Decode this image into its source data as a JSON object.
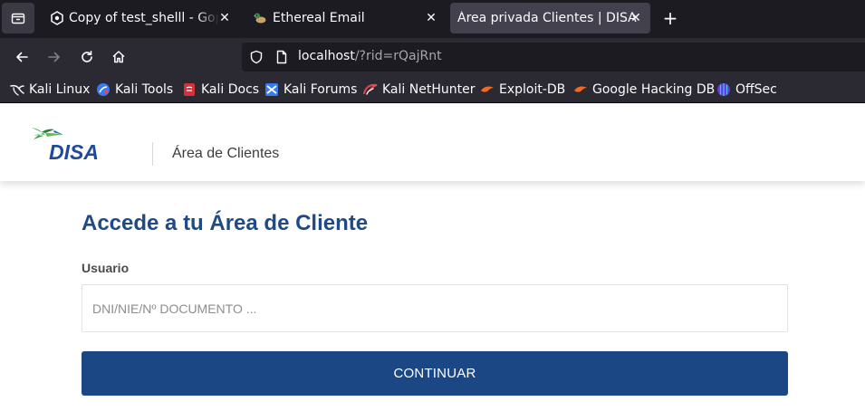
{
  "browser": {
    "tabs": [
      {
        "title": "Copy of test_shelll - Gophish",
        "favicon": "gophish-hex-icon",
        "active": false
      },
      {
        "title": "Ethereal Email",
        "favicon": "duck-icon",
        "active": false
      },
      {
        "title": "Área privada Clientes | DISA",
        "favicon": "none",
        "active": true
      }
    ],
    "close_glyph": "✕",
    "newtab_glyph": "+",
    "url_host": "localhost",
    "url_path": "/?rid=rQajRnt",
    "bookmarks": [
      {
        "label": "Kali Linux",
        "icon": "kali-dragon-icon"
      },
      {
        "label": "Kali Tools",
        "icon": "kali-tools-icon"
      },
      {
        "label": "Kali Docs",
        "icon": "kali-docs-icon"
      },
      {
        "label": "Kali Forums",
        "icon": "kali-forums-icon"
      },
      {
        "label": "Kali NetHunter",
        "icon": "nethunter-icon"
      },
      {
        "label": "Exploit-DB",
        "icon": "exploit-db-icon"
      },
      {
        "label": "Google Hacking DB",
        "icon": "ghdb-icon"
      },
      {
        "label": "OffSec",
        "icon": "offsec-icon"
      }
    ]
  },
  "header": {
    "logo_text": "DISA",
    "section_title": "Área de Clientes"
  },
  "login": {
    "title": "Accede a tu Área de Cliente",
    "user_label": "Usuario",
    "user_value": "",
    "user_placeholder": "DNI/NIE/Nº DOCUMENTO ...",
    "submit_label": "CONTINUAR"
  },
  "colors": {
    "brand_blue": "#1c4785",
    "title_blue": "#1f4a86",
    "logo_green": "#3aa844"
  }
}
